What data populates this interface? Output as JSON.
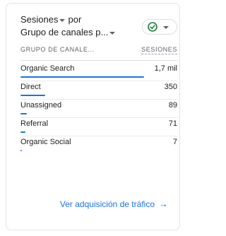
{
  "card": {
    "title_line1": "Sesiones",
    "title_by": "por",
    "title_line2": "Grupo de canales p...",
    "check_icon": "check-circle-icon",
    "accent_color": "#1a73e8",
    "check_color": "#188038"
  },
  "table": {
    "col_dimension": "GRUPO DE CANALE...",
    "col_metric": "SESIONES",
    "rows": [
      {
        "label": "Organic Search",
        "value": "1,7 mil",
        "share": 1.0
      },
      {
        "label": "Direct",
        "value": "350",
        "share": 0.2
      },
      {
        "label": "Unassigned",
        "value": "89",
        "share": 0.052
      },
      {
        "label": "Referral",
        "value": "71",
        "share": 0.042
      },
      {
        "label": "Organic Social",
        "value": "7",
        "share": 0.004
      }
    ]
  },
  "footer": {
    "link_label": "Ver adquisición de tráfico",
    "link_icon": "arrow-right-icon"
  }
}
